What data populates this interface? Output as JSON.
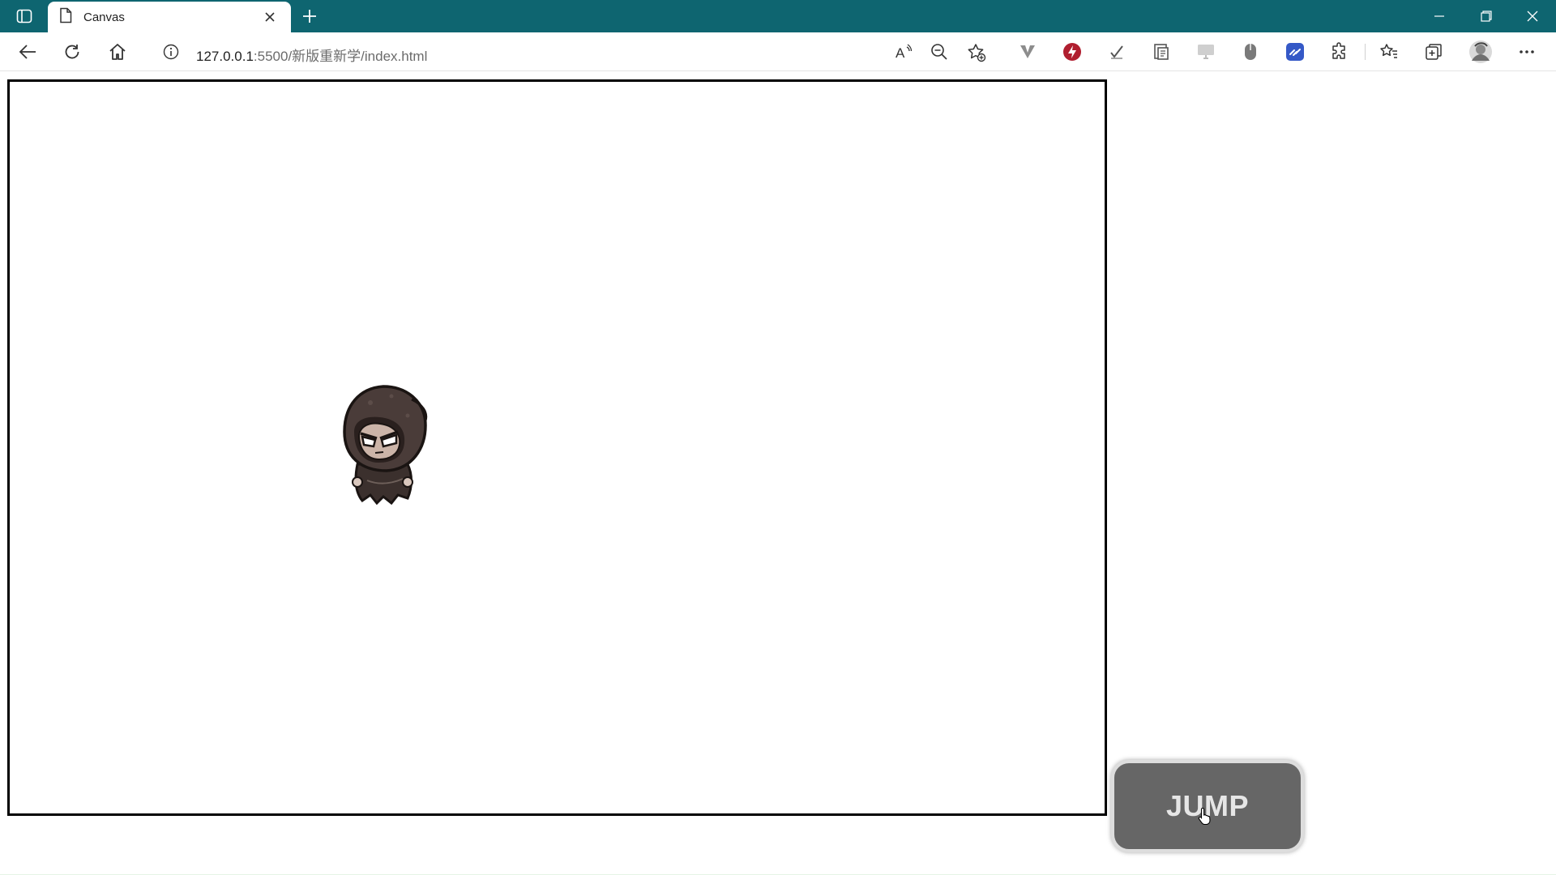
{
  "browser": {
    "tab": {
      "title": "Canvas"
    },
    "address": {
      "host": "127.0.0.1",
      "path": ":5500/新版重新学/index.html"
    }
  },
  "page": {
    "jump_button": {
      "label": "JUMP"
    },
    "sprite": {
      "description_icon": "hooded-character-sprite"
    }
  },
  "colors": {
    "titlebar": "#0e6570",
    "canvas_border": "#000000",
    "jump_bg": "#666666",
    "jump_text": "#e6e6e6"
  }
}
